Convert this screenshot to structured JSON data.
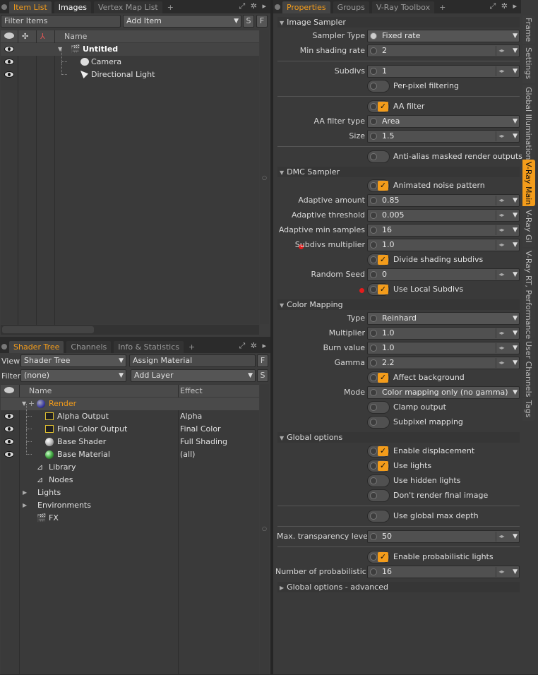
{
  "item_list": {
    "tabs": [
      "Item List",
      "Images",
      "Vertex Map List"
    ],
    "filter_placeholder": "Filter Items",
    "add_item": "Add Item",
    "btn_s": "S",
    "btn_f": "F",
    "col_name": "Name",
    "items": [
      {
        "label": "Untitled",
        "icon": "scene-clapper-icon"
      },
      {
        "label": "Camera",
        "icon": "camera-icon"
      },
      {
        "label": "Directional Light",
        "icon": "light-icon"
      }
    ]
  },
  "shader_tree": {
    "tabs": [
      "Shader Tree",
      "Channels",
      "Info & Statistics"
    ],
    "view_label": "View",
    "view_value": "Shader Tree",
    "assign_material": "Assign Material",
    "filter_label": "Filter",
    "filter_value": "(none)",
    "add_layer": "Add Layer",
    "btn_f": "F",
    "btn_s": "S",
    "col_name": "Name",
    "col_effect": "Effect",
    "rows": [
      {
        "name": "Render",
        "effect": ""
      },
      {
        "name": "Alpha Output",
        "effect": "Alpha"
      },
      {
        "name": "Final Color Output",
        "effect": "Final Color"
      },
      {
        "name": "Base Shader",
        "effect": "Full Shading"
      },
      {
        "name": "Base Material",
        "effect": "(all)"
      },
      {
        "name": "Library",
        "effect": ""
      },
      {
        "name": "Nodes",
        "effect": ""
      },
      {
        "name": "Lights",
        "effect": ""
      },
      {
        "name": "Environments",
        "effect": ""
      },
      {
        "name": "FX",
        "effect": ""
      }
    ]
  },
  "properties": {
    "tabs": [
      "Properties",
      "Groups",
      "V-Ray Toolbox"
    ],
    "image_sampler": "Image Sampler",
    "sampler_type_label": "Sampler Type",
    "sampler_type": "Fixed rate",
    "min_shading_rate_label": "Min shading rate",
    "min_shading_rate": "2",
    "subdivs_label": "Subdivs",
    "subdivs": "1",
    "per_pixel": "Per-pixel filtering",
    "aa_filter": "AA filter",
    "aa_filter_type_label": "AA filter type",
    "aa_filter_type": "Area",
    "size_label": "Size",
    "size": "1.5",
    "anti_alias_masked": "Anti-alias masked render outputs",
    "dmc_sampler": "DMC Sampler",
    "animated_noise": "Animated noise pattern",
    "adaptive_amount_label": "Adaptive amount",
    "adaptive_amount": "0.85",
    "adaptive_threshold_label": "Adaptive threshold",
    "adaptive_threshold": "0.005",
    "adaptive_min_label": "Adaptive min samples",
    "adaptive_min": "16",
    "subdivs_mult_label": "Subdivs multiplier",
    "subdivs_mult": "1.0",
    "divide_shading": "Divide shading subdivs",
    "random_seed_label": "Random Seed",
    "random_seed": "0",
    "use_local_subdivs": "Use Local Subdivs",
    "color_mapping": "Color Mapping",
    "type_label": "Type",
    "type": "Reinhard",
    "multiplier_label": "Multiplier",
    "multiplier": "1.0",
    "burn_label": "Burn value",
    "burn": "1.0",
    "gamma_label": "Gamma",
    "gamma": "2.2",
    "affect_bg": "Affect background",
    "mode_label": "Mode",
    "mode": "Color mapping only (no gamma)",
    "clamp_output": "Clamp output",
    "subpixel": "Subpixel mapping",
    "global_options": "Global options",
    "enable_disp": "Enable displacement",
    "use_lights": "Use lights",
    "use_hidden": "Use hidden lights",
    "dont_render": "Don't render final image",
    "use_global_max": "Use global max depth",
    "max_transp_label": "Max. transparency levels",
    "max_transp": "50",
    "enable_prob": "Enable probabilistic lights",
    "num_prob_label": "Number of probabilistic l...",
    "num_prob": "16",
    "global_adv": "Global options - advanced"
  },
  "side_tabs": [
    "Frame",
    "Settings",
    "Global Illumination",
    "V-Ray Main",
    "V-Ray GI",
    "V-Ray RT, Performance",
    "User Channels",
    "Tags"
  ],
  "colors": {
    "accent": "#f39c1b",
    "panel": "#3c3c3c",
    "red": "#e51c1c"
  }
}
